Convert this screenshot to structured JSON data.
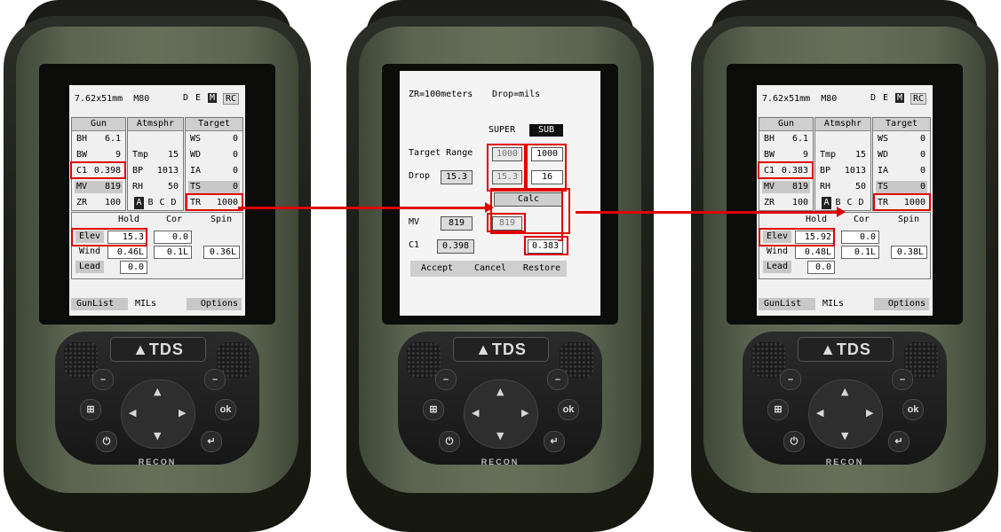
{
  "brand_logo": "▲TDS",
  "brand_label": "RECON",
  "device1": {
    "cartridge": "7.62x51mm",
    "load": "M80",
    "modes": [
      "D",
      "E",
      "M",
      "RC"
    ],
    "gun_header": "Gun",
    "atm_header": "Atmsphr",
    "target_header": "Target",
    "gun": [
      [
        "BH",
        "6.1"
      ],
      [
        "BW",
        "9"
      ],
      [
        "C1",
        "0.398"
      ],
      [
        "MV",
        "819"
      ],
      [
        "ZR",
        "100"
      ]
    ],
    "atm": [
      [
        "Tmp",
        "15"
      ],
      [
        "BP",
        "1013"
      ],
      [
        "RH",
        "50"
      ]
    ],
    "abcd": [
      "A",
      "B",
      "C",
      "D"
    ],
    "target": [
      [
        "WS",
        "0"
      ],
      [
        "WD",
        "0"
      ],
      [
        "IA",
        "0"
      ],
      [
        "TS",
        "0"
      ],
      [
        "TR",
        "1000"
      ]
    ],
    "hold_header": "Hold",
    "cor_header": "Cor",
    "spin_header": "Spin",
    "elev_label": "Elev",
    "elev_hold": "15.3",
    "elev_cor": "0.0",
    "wind_label": "Wind",
    "wind_hold": "0.46L",
    "wind_cor": "0.1L",
    "wind_spin": "0.36L",
    "lead_label": "Lead",
    "lead_hold": "0.0",
    "gunlist": "GunList",
    "units": "MILs",
    "options": "Options"
  },
  "device2": {
    "zr": "ZR=100meters",
    "drop_units": "Drop=mils",
    "super": "SUPER",
    "sub": "SUB",
    "target_range_label": "Target Range",
    "range_super": "1000",
    "range_sub": "1000",
    "drop_label": "Drop",
    "drop_value": "15.3",
    "drop_super": "15.3",
    "drop_sub": "16",
    "calc": "Calc",
    "mv_label": "MV",
    "mv_value": "819",
    "mv_super": "819",
    "c1_label": "C1",
    "c1_value": "0.398",
    "c1_sub": "0.383",
    "accept": "Accept",
    "cancel": "Cancel",
    "restore": "Restore"
  },
  "device3": {
    "cartridge": "7.62x51mm",
    "load": "M80",
    "modes": [
      "D",
      "E",
      "M",
      "RC"
    ],
    "gun_header": "Gun",
    "atm_header": "Atmsphr",
    "target_header": "Target",
    "gun": [
      [
        "BH",
        "6.1"
      ],
      [
        "BW",
        "9"
      ],
      [
        "C1",
        "0.383"
      ],
      [
        "MV",
        "819"
      ],
      [
        "ZR",
        "100"
      ]
    ],
    "atm": [
      [
        "Tmp",
        "15"
      ],
      [
        "BP",
        "1013"
      ],
      [
        "RH",
        "50"
      ]
    ],
    "abcd": [
      "A",
      "B",
      "C",
      "D"
    ],
    "target": [
      [
        "WS",
        "0"
      ],
      [
        "WD",
        "0"
      ],
      [
        "IA",
        "0"
      ],
      [
        "TS",
        "0"
      ],
      [
        "TR",
        "1000"
      ]
    ],
    "hold_header": "Hold",
    "cor_header": "Cor",
    "spin_header": "Spin",
    "elev_label": "Elev",
    "elev_hold": "15.92",
    "elev_cor": "0.0",
    "wind_label": "Wind",
    "wind_hold": "0.48L",
    "wind_cor": "0.1L",
    "wind_spin": "0.38L",
    "lead_label": "Lead",
    "lead_hold": "0.0",
    "gunlist": "GunList",
    "units": "MILs",
    "options": "Options"
  },
  "colors": {
    "highlight_red": "#e00000",
    "device_green": "#5a6450"
  },
  "icons": [
    "windows-icon",
    "ok-icon",
    "power-icon",
    "enter-icon",
    "dpad-up-icon",
    "dpad-down-icon",
    "dpad-left-icon",
    "dpad-right-icon"
  ]
}
